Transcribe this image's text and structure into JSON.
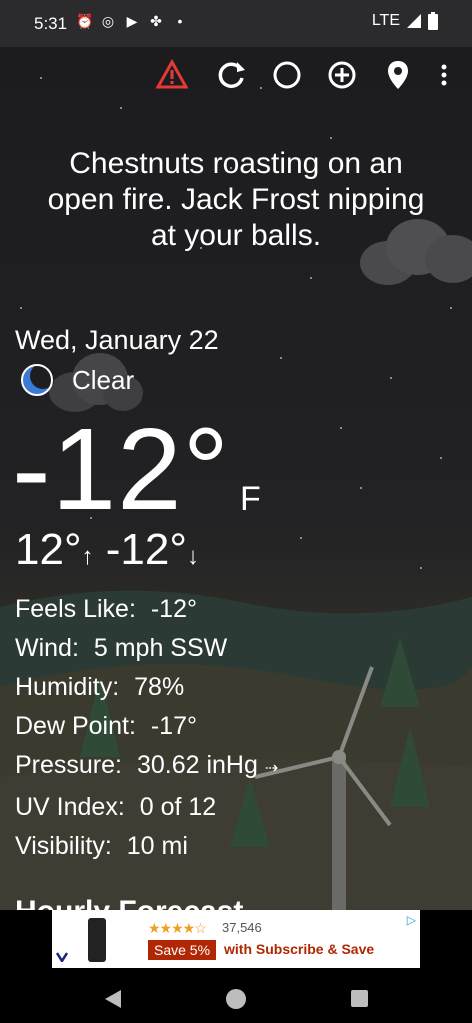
{
  "status": {
    "time": "5:31",
    "network": "LTE"
  },
  "toolbar": {
    "icons": [
      "alert-icon",
      "refresh-icon",
      "theme-icon",
      "add-location-icon",
      "location-pin-icon",
      "more-options-icon"
    ]
  },
  "quote": {
    "line1": "Chestnuts roasting on an",
    "line2": "open fire. Jack Frost nipping",
    "line3": "at your balls."
  },
  "weather": {
    "date": "Wed, January 22",
    "condition": "Clear",
    "temperature": "-12°",
    "unit": "F",
    "high": "12°",
    "low": "-12°"
  },
  "details": {
    "feels_label": "Feels Like:",
    "feels_value": "-12°",
    "wind_label": "Wind:",
    "wind_value": "5 mph SSW",
    "humidity_label": "Humidity:",
    "humidity_value": "78%",
    "dew_label": "Dew Point:",
    "dew_value": "-17°",
    "pressure_label": "Pressure:",
    "pressure_value": "30.62 inHg",
    "uv_label": "UV Index:",
    "uv_value": "0 of 12",
    "visibility_label": "Visibility:",
    "visibility_value": "10 mi"
  },
  "hourly": {
    "heading": "Hourly Forecast"
  },
  "ad": {
    "stars": "★★★★☆",
    "rating_count": "37,546",
    "save_badge": "Save 5%",
    "save_text": "with Subscribe & Save"
  },
  "colors": {
    "alert": "#e53935",
    "moon": "#3a7bd5",
    "background": "#1e1e21"
  }
}
